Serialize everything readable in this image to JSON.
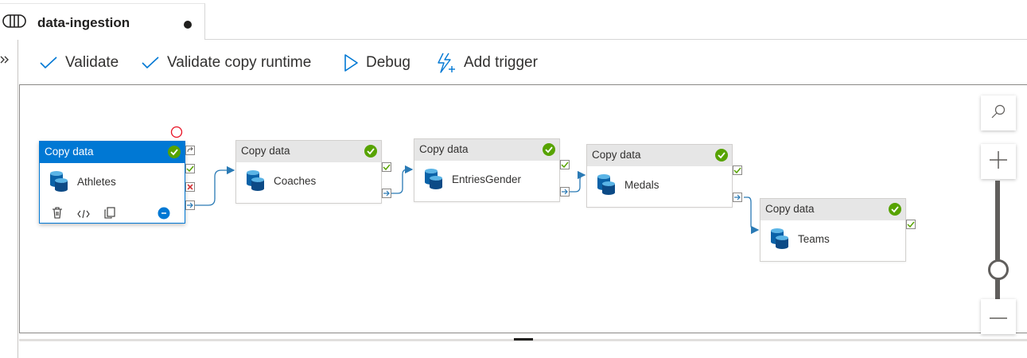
{
  "tab": {
    "title": "data-ingestion",
    "icon": "pipeline-icon",
    "unsaved": true
  },
  "rail": {
    "expand_icon": "double-chevron-right-icon"
  },
  "toolbar": {
    "validate": "Validate",
    "validate_copy_runtime": "Validate copy runtime",
    "debug": "Debug",
    "add_trigger": "Add trigger"
  },
  "activities": [
    {
      "type": "Copy data",
      "name": "Athletes",
      "status": "succeeded",
      "selected": true
    },
    {
      "type": "Copy data",
      "name": "Coaches",
      "status": "succeeded",
      "selected": false
    },
    {
      "type": "Copy data",
      "name": "EntriesGender",
      "status": "succeeded",
      "selected": false
    },
    {
      "type": "Copy data",
      "name": "Medals",
      "status": "succeeded",
      "selected": false
    },
    {
      "type": "Copy data",
      "name": "Teams",
      "status": "succeeded",
      "selected": false
    }
  ],
  "colors": {
    "accent": "#0078d4",
    "success": "#57a300",
    "failure": "#d13438",
    "connector": "#2a7ab5"
  }
}
